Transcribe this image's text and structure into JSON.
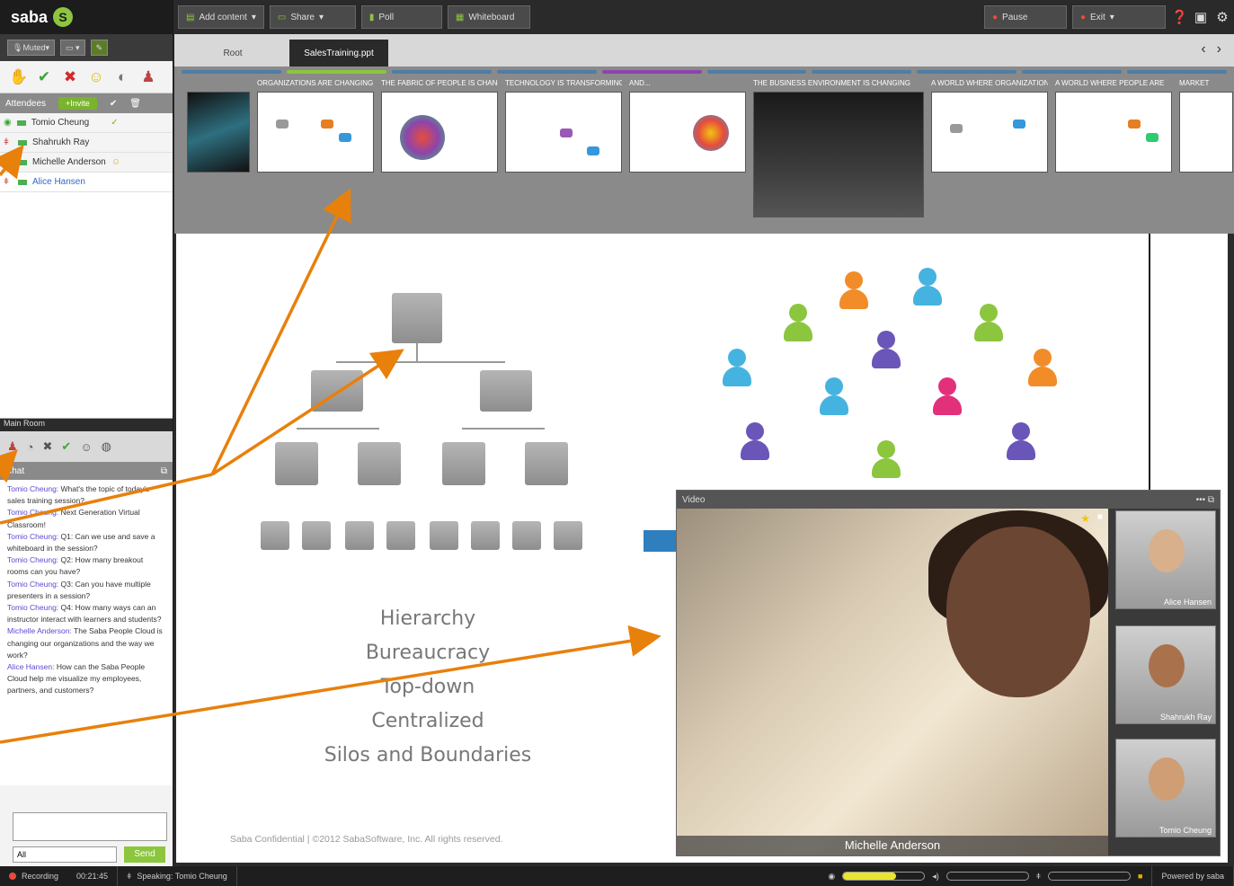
{
  "app": {
    "logo": "saba"
  },
  "toolbar": {
    "add_content": "Add content",
    "share": "Share",
    "poll": "Poll",
    "whiteboard": "Whiteboard",
    "pause": "Pause",
    "exit": "Exit"
  },
  "av_controls": {
    "muted": "Muted"
  },
  "attendees": {
    "header": "Attendees",
    "invite": "+Invite",
    "list": [
      {
        "name": "Tomio Cheung"
      },
      {
        "name": "Shahrukh Ray"
      },
      {
        "name": "Michelle Anderson"
      },
      {
        "name": "Alice Hansen"
      }
    ]
  },
  "room": {
    "title": "Main Room"
  },
  "chat": {
    "header": "Chat",
    "messages": [
      {
        "who": "Tomio Cheung:",
        "text": " What's the topic of today's sales training session?"
      },
      {
        "who": "Tomio Cheung:",
        "text": " Next Generation Virtual Classroom!"
      },
      {
        "who": "Tomio Cheung:",
        "text": " Q1: Can we use and save a whiteboard in the session?"
      },
      {
        "who": "Tomio Cheung:",
        "text": " Q2: How many breakout rooms can you have?"
      },
      {
        "who": "Tomio Cheung:",
        "text": " Q3: Can you have multiple presenters in a session?"
      },
      {
        "who": "Tomio Cheung:",
        "text": " Q4: How many ways can an instructor interact with learners and students?"
      },
      {
        "who": "Michelle Anderson:",
        "text": " The Saba People Cloud is changing our organizations and the way we work?"
      },
      {
        "who": "Alice Hansen:",
        "text": " How can the Saba People Cloud help me visualize my employees, partners, and customers?"
      }
    ],
    "filter": "All",
    "send": "Send"
  },
  "tabs": [
    {
      "label": "Root",
      "active": false
    },
    {
      "label": "SalesTraining.ppt",
      "active": true
    }
  ],
  "thumbnails": [
    {
      "title": ""
    },
    {
      "title": "ORGANIZATIONS ARE CHANGING"
    },
    {
      "title": "THE FABRIC OF PEOPLE IS CHANGING"
    },
    {
      "title": "TECHNOLOGY IS TRANSFORMING"
    },
    {
      "title": "AND..."
    },
    {
      "title": "THE BUSINESS ENVIRONMENT IS CHANGING"
    },
    {
      "title": "A WORLD WHERE ORGANIZATIONS"
    },
    {
      "title": "A WORLD WHERE PEOPLE ARE"
    },
    {
      "title": "MARKET"
    }
  ],
  "slide": {
    "words": [
      "Hierarchy",
      "Bureaucracy",
      "Top-down",
      "Centralized",
      "Silos and Boundaries"
    ],
    "footer": "Saba Confidential | ©2012 SabaSoftware, Inc. All rights reserved."
  },
  "video": {
    "title": "Video",
    "main_name": "Michelle Anderson",
    "side": [
      {
        "name": "Alice Hansen"
      },
      {
        "name": "Shahrukh Ray"
      },
      {
        "name": "Tomio Cheung"
      }
    ]
  },
  "statusbar": {
    "recording": "Recording",
    "time": "00:21:45",
    "speaking": "Speaking: Tomio Cheung",
    "powered": "Powered by saba",
    "audio_level": 0.65
  },
  "colors": {
    "accent_green": "#8cc63f",
    "arrow_orange": "#e8800c",
    "dark": "#2a2a2a"
  }
}
